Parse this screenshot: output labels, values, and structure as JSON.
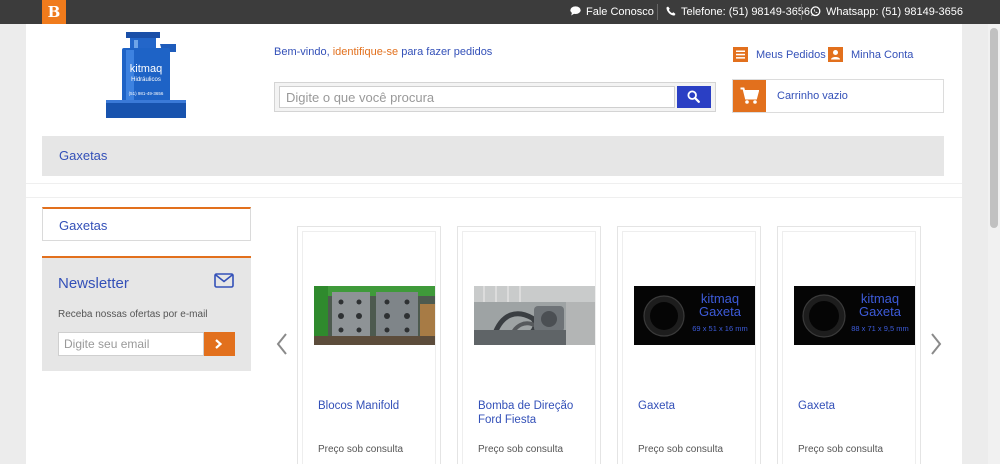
{
  "topbar": {
    "brand_letter": "B",
    "contact": "Fale Conosco",
    "phone": "Telefone: (51) 98149-3656",
    "whatsapp": "Whatsapp: (51) 98149-3656"
  },
  "logo": {
    "line1": "kitmaq",
    "line2": "Hidráulicos",
    "line3": "(51) 981-49-3656"
  },
  "header": {
    "welcome_prefix": "Bem-vindo, ",
    "welcome_link": "identifique-se",
    "welcome_suffix": " para fazer pedidos",
    "search_placeholder": "Digite o que você procura",
    "orders": "Meus Pedidos",
    "account": "Minha Conta",
    "cart": "Carrinho vazio"
  },
  "category": {
    "title": "Gaxetas"
  },
  "sidebar": {
    "category": "Gaxetas",
    "newsletter_title": "Newsletter",
    "newsletter_desc": "Receba nossas ofertas por e-mail",
    "email_placeholder": "Digite seu email"
  },
  "products": [
    {
      "name": "Blocos Manifold",
      "price": "Preço sob consulta"
    },
    {
      "name": "Bomba de Direção Ford Fiesta",
      "price": "Preço sob consulta"
    },
    {
      "name": "Gaxeta",
      "price": "Preço sob consulta",
      "img_brand": "kitmaq",
      "img_label": "Gaxeta",
      "img_dims": "69 x 51 x 16 mm"
    },
    {
      "name": "Gaxeta",
      "price": "Preço sob consulta",
      "img_brand": "kitmaq",
      "img_label": "Gaxeta",
      "img_dims": "88 x 71 x 9,5 mm"
    }
  ],
  "colors": {
    "accent": "#e2701d",
    "link": "#3350b8",
    "search_button": "#2a3fc4",
    "topbar": "#3c3c3c"
  }
}
